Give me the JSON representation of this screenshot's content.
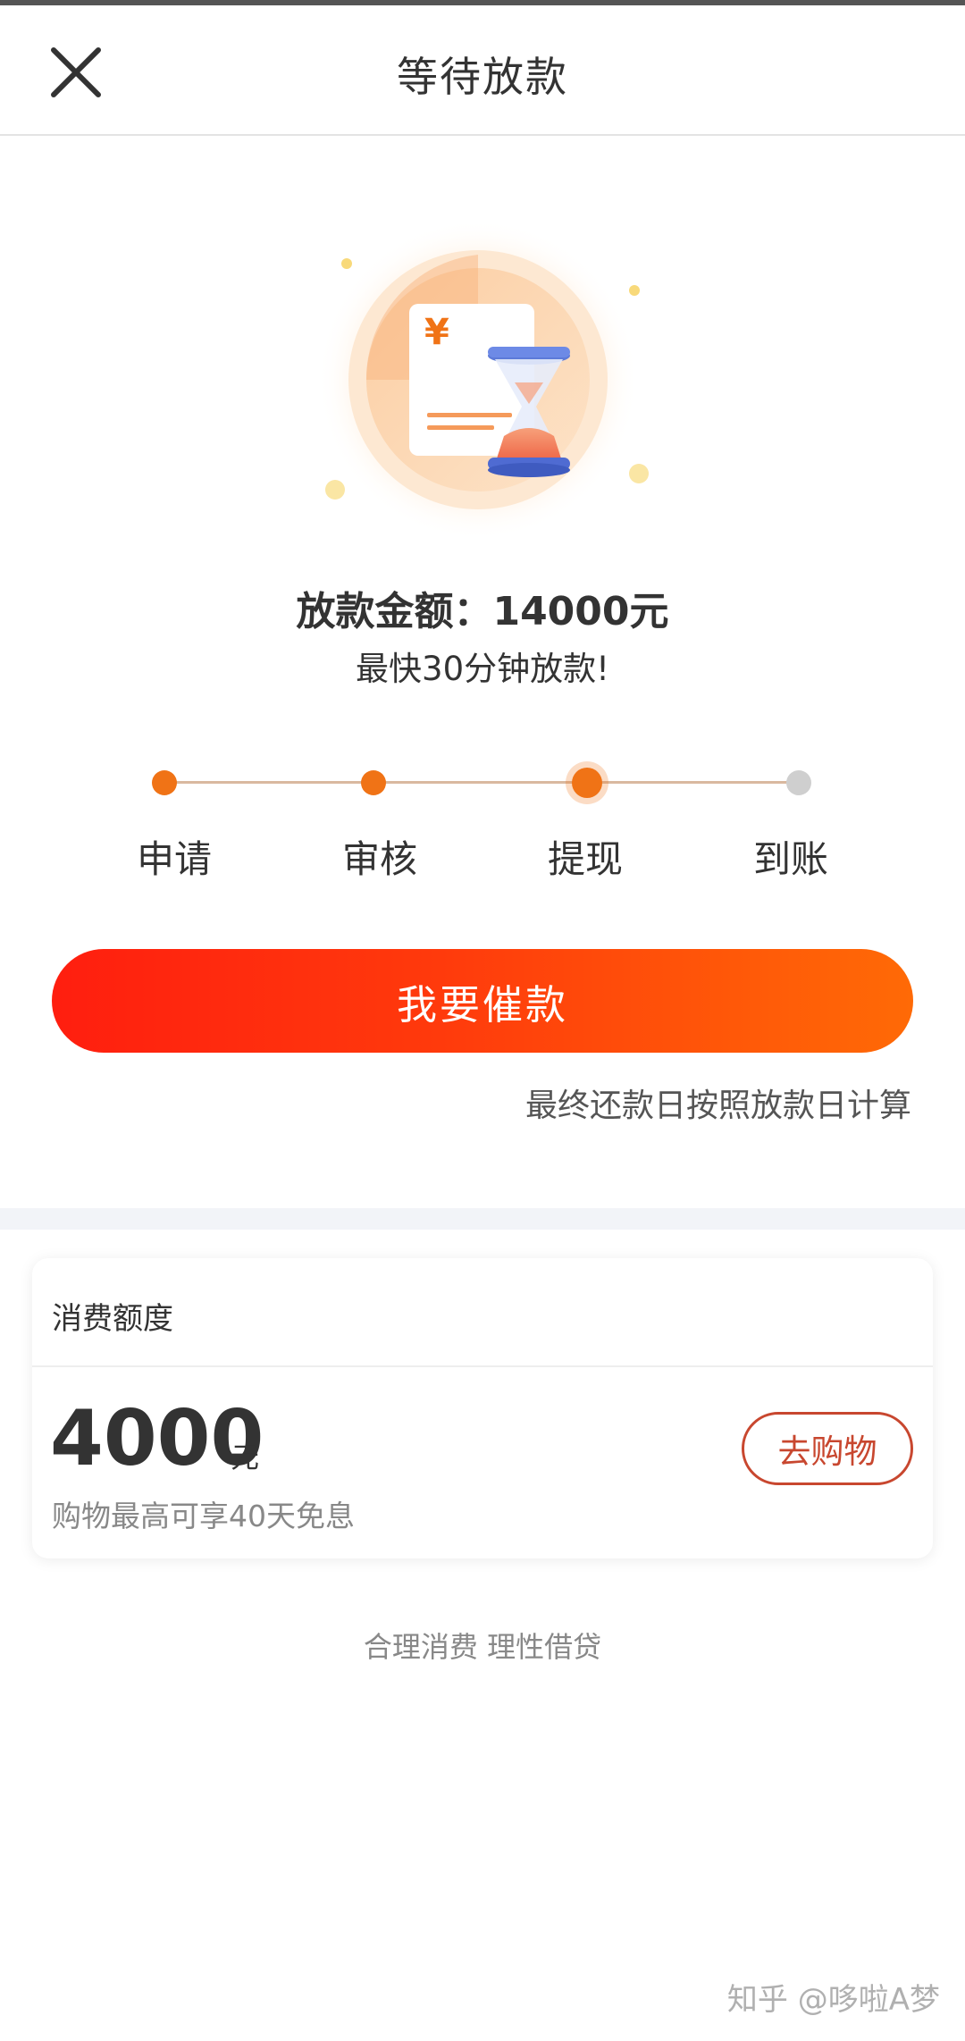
{
  "header": {
    "title": "等待放款",
    "close_icon": "close-icon"
  },
  "hero": {
    "illustration": "money-hourglass-illustration",
    "currency_symbol": "¥"
  },
  "loan": {
    "amount_label": "放款金额：14000元",
    "speed_note": "最快30分钟放款!"
  },
  "steps": [
    {
      "label": "申请",
      "state": "done"
    },
    {
      "label": "审核",
      "state": "done"
    },
    {
      "label": "提现",
      "state": "current"
    },
    {
      "label": "到账",
      "state": "pending"
    }
  ],
  "actions": {
    "urge_label": "我要催款",
    "repay_note": "最终还款日按照放款日计算"
  },
  "credit_card": {
    "title": "消费额度",
    "amount": "4000",
    "unit": "元",
    "description": "购物最高可享40天免息",
    "shop_label": "去购物"
  },
  "footer": {
    "slogan": "合理消费 理性借贷",
    "watermark": "知乎 @哆啦A梦"
  },
  "colors": {
    "accent": "#f07316",
    "button_start": "#ff1e0f",
    "button_end": "#ff6a06",
    "shop_outline": "#c8472f"
  }
}
